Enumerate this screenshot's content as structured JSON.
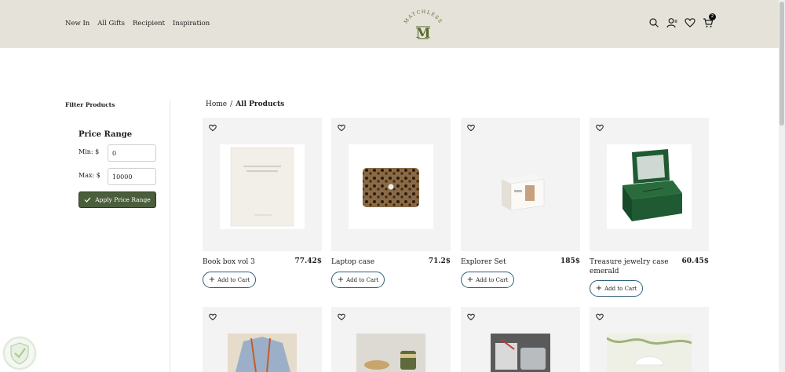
{
  "header": {
    "nav": [
      {
        "label": "New In"
      },
      {
        "label": "All Gifts"
      },
      {
        "label": "Recipient"
      },
      {
        "label": "Inspiration"
      }
    ],
    "logo_text": "MATCHLESS",
    "logo_letter": "M",
    "cart_count": "2",
    "icons": [
      "search-icon",
      "user-icon",
      "heart-icon",
      "cart-icon"
    ]
  },
  "sidebar": {
    "title": "Filter Products",
    "price_range": {
      "title": "Price Range",
      "min_label": "Min: $",
      "min_value": "0",
      "max_label": "Max: $",
      "max_value": "10000",
      "apply_label": "Apply Price Range"
    }
  },
  "breadcrumb": {
    "home": "Home",
    "separator": "/",
    "current": "All Products"
  },
  "products": [
    {
      "name": "Book box vol 3",
      "price": "77.42$",
      "add_label": "Add to Cart"
    },
    {
      "name": "Laptop case",
      "price": "71.2$",
      "add_label": "Add to Cart"
    },
    {
      "name": "Explorer Set",
      "price": "185$",
      "add_label": "Add to Cart"
    },
    {
      "name": "Treasure jewelry case emerald",
      "price": "60.45$",
      "add_label": "Add to Cart"
    }
  ],
  "colors": {
    "header_bg": "#e5e3d9",
    "apply_button": "#4b5e3c",
    "add_button_border": "#2f5f78",
    "logo": "#5a6a2a"
  }
}
